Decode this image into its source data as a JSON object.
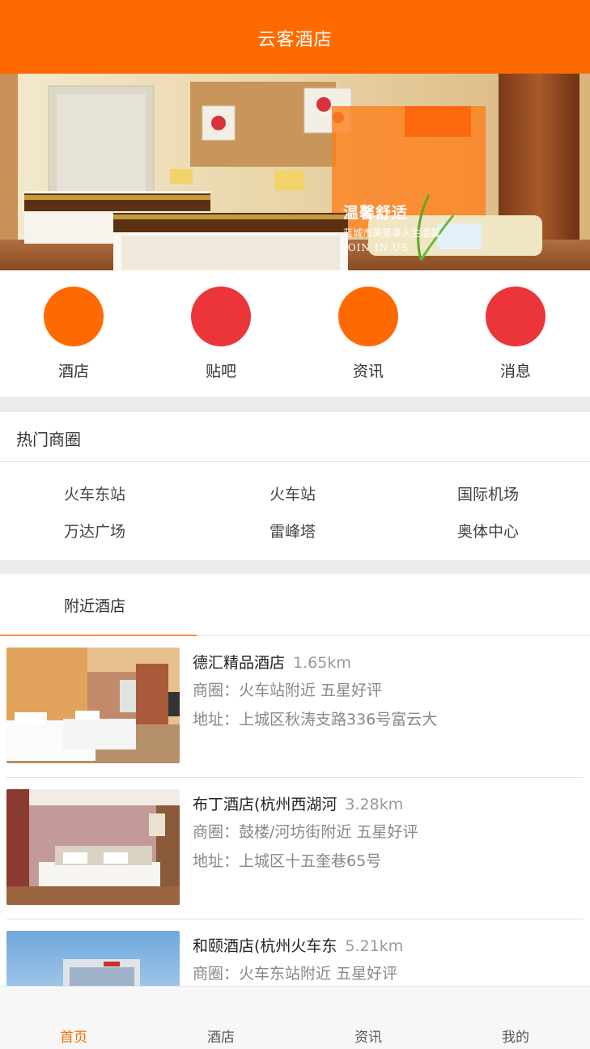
{
  "header": {
    "title": "云客酒店"
  },
  "banner": {
    "headline": "温馨舒适",
    "subline": "蓝城市美景享人生温馨",
    "english": "JOIN IN US",
    "accent_color": "#ff7d1a"
  },
  "quick_nav": [
    {
      "label": "酒店",
      "icon": "hotel-icon",
      "color": "#ff6a00"
    },
    {
      "label": "贴吧",
      "icon": "forum-icon",
      "color": "#ec3538"
    },
    {
      "label": "资讯",
      "icon": "news-icon",
      "color": "#ff6a00"
    },
    {
      "label": "消息",
      "icon": "message-icon",
      "color": "#ec3538"
    }
  ],
  "hot_areas": {
    "title": "热门商圈",
    "items": [
      "火车东站",
      "火车站",
      "国际机场",
      "万达广场",
      "雷峰塔",
      "奥体中心"
    ]
  },
  "nearby": {
    "title": "附近酒店",
    "hotels": [
      {
        "name": "德汇精品酒店",
        "distance": "1.65km",
        "area": "商圈：火车站附近   五星好评",
        "address": "地址：上城区秋涛支路336号富云大"
      },
      {
        "name": "布丁酒店(杭州西湖河",
        "distance": "3.28km",
        "area": "商圈：鼓楼/河坊街附近   五星好评",
        "address": "地址：上城区十五奎巷65号"
      },
      {
        "name": "和颐酒店(杭州火车东",
        "distance": "5.21km",
        "area": "商圈：火车东站附近   五星好评",
        "address": ""
      }
    ]
  },
  "tabbar": {
    "items": [
      {
        "label": "首页",
        "active": true
      },
      {
        "label": "酒店",
        "active": false
      },
      {
        "label": "资讯",
        "active": false
      },
      {
        "label": "我的",
        "active": false
      }
    ],
    "active_color": "#ff6a00"
  }
}
